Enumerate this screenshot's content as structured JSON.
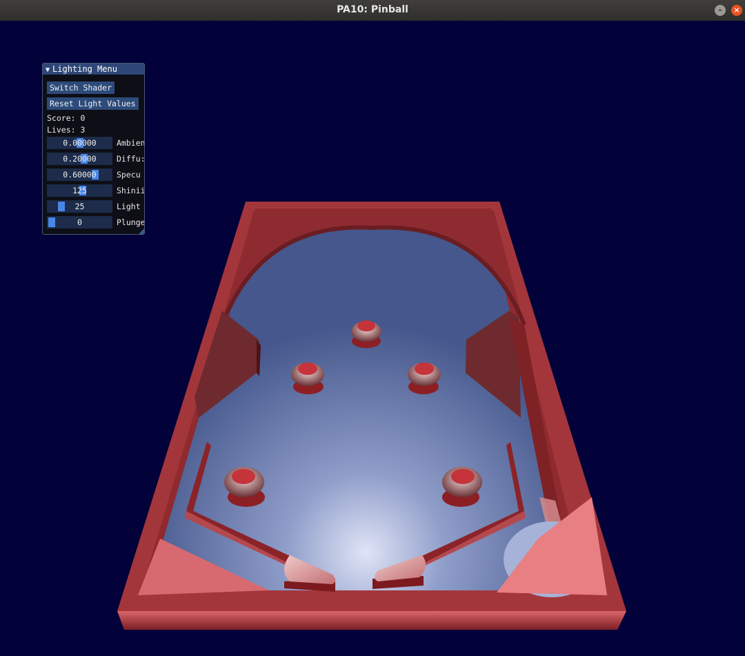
{
  "window": {
    "title": "PA10: Pinball",
    "min_glyph": "–",
    "max_glyph": "□",
    "close_glyph": "×"
  },
  "menu": {
    "title": "Lighting Menu",
    "collapse_glyph": "▼",
    "switch_shader_label": "Switch Shader",
    "reset_light_label": "Reset Light Values",
    "score_text": "Score: 0",
    "lives_text": "Lives: 3",
    "sliders": [
      {
        "value": "0.00000",
        "label": "Ambien",
        "level": 0.5
      },
      {
        "value": "0.20000",
        "label": "Diffu:",
        "level": 0.58
      },
      {
        "value": "0.60000",
        "label": "Specu",
        "level": 0.78
      },
      {
        "value": "125",
        "label": "Shinii",
        "level": 0.55
      },
      {
        "value": "25",
        "label": "Light",
        "level": 0.17
      },
      {
        "value": "0",
        "label": "Plunge",
        "level": 0.0
      }
    ]
  },
  "colors": {
    "background": "#02013a",
    "table_wood": "#a8383c",
    "playfield": "#4a5f96",
    "accent": "#4a86e8",
    "menu_header": "#2f4777"
  }
}
